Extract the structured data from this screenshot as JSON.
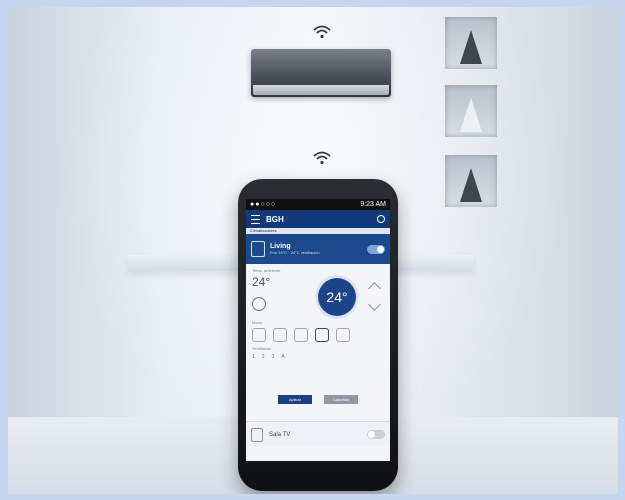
{
  "status_bar": {
    "signal": "●●○○○",
    "time": "9:23 AM"
  },
  "app_bar": {
    "title": "BGH"
  },
  "sub_bar": {
    "label": "Climatizadores"
  },
  "device_living": {
    "name": "Living",
    "subtitle": "Frío 24°C · 24°C ventilación"
  },
  "temperature": {
    "label": "Temp. ambiente",
    "current": "24°",
    "setpoint": "24°"
  },
  "modes": {
    "label": "Modo",
    "items": [
      "frío",
      "calor",
      "auto",
      "deshum",
      "vent"
    ]
  },
  "fan": {
    "label": "Ventilación",
    "levels": [
      "1",
      "2",
      "3",
      "A"
    ]
  },
  "buttons": {
    "primary": "Aplicar",
    "secondary": "Cancelar"
  },
  "device_sala": {
    "name": "Sala TV"
  },
  "colors": {
    "brand_blue": "#123a7a",
    "page_bg": "#c5d6ee"
  }
}
